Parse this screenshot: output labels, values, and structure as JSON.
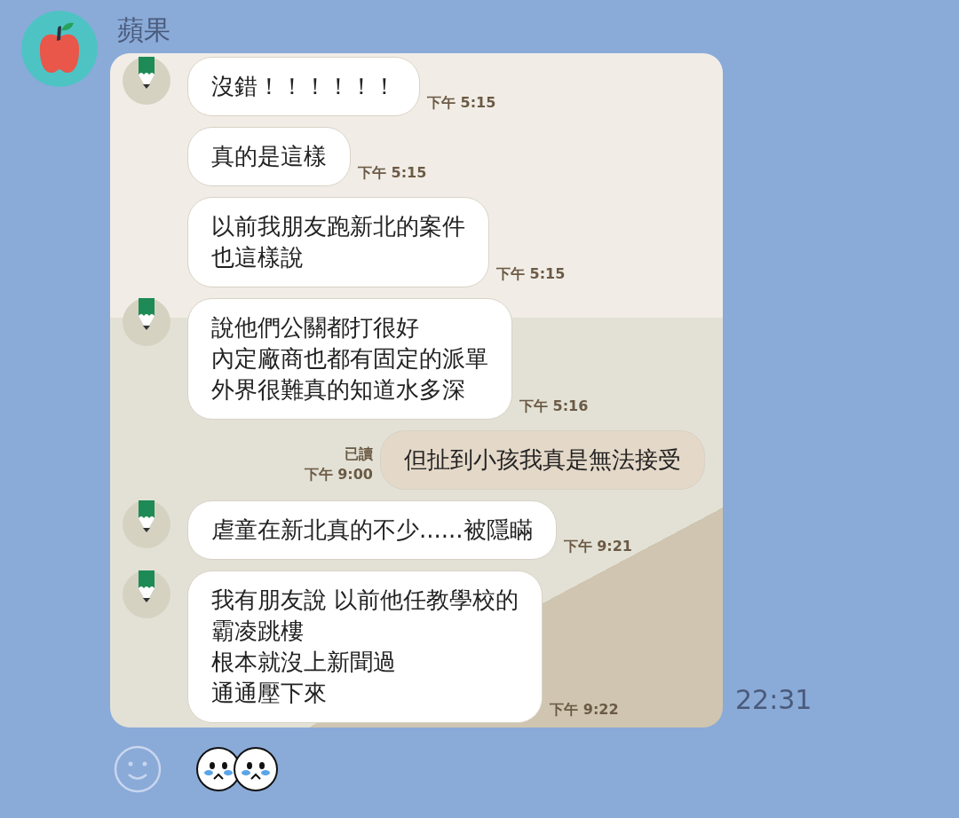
{
  "contact": {
    "name": "蘋果"
  },
  "screenshot": {
    "messages": [
      {
        "kind": "incoming",
        "avatar": true,
        "lines": [
          "沒錯！！！！！！"
        ],
        "time": "下午 5:15"
      },
      {
        "kind": "incoming",
        "avatar": false,
        "lines": [
          "真的是這樣"
        ],
        "time": "下午 5:15"
      },
      {
        "kind": "incoming",
        "avatar": false,
        "lines": [
          "以前我朋友跑新北的案件",
          "也這樣說"
        ],
        "time": "下午 5:15"
      },
      {
        "kind": "incoming",
        "avatar": true,
        "lines": [
          "說他們公關都打很好",
          "內定廠商也都有固定的派單",
          "外界很難真的知道水多深"
        ],
        "time": "下午 5:16"
      },
      {
        "kind": "outgoing",
        "read": "已讀",
        "lines": [
          "但扯到小孩我真是無法接受"
        ],
        "time": "下午 9:00"
      },
      {
        "kind": "incoming",
        "avatar": true,
        "lines": [
          "虐童在新北真的不少......被隱瞞"
        ],
        "time": "下午 9:21"
      },
      {
        "kind": "incoming",
        "avatar": true,
        "lines": [
          "我有朋友說 以前他任教學校的",
          "霸凌跳樓",
          "根本就沒上新聞過",
          "通通壓下來"
        ],
        "time": "下午 9:22"
      }
    ]
  },
  "time": "22:31"
}
